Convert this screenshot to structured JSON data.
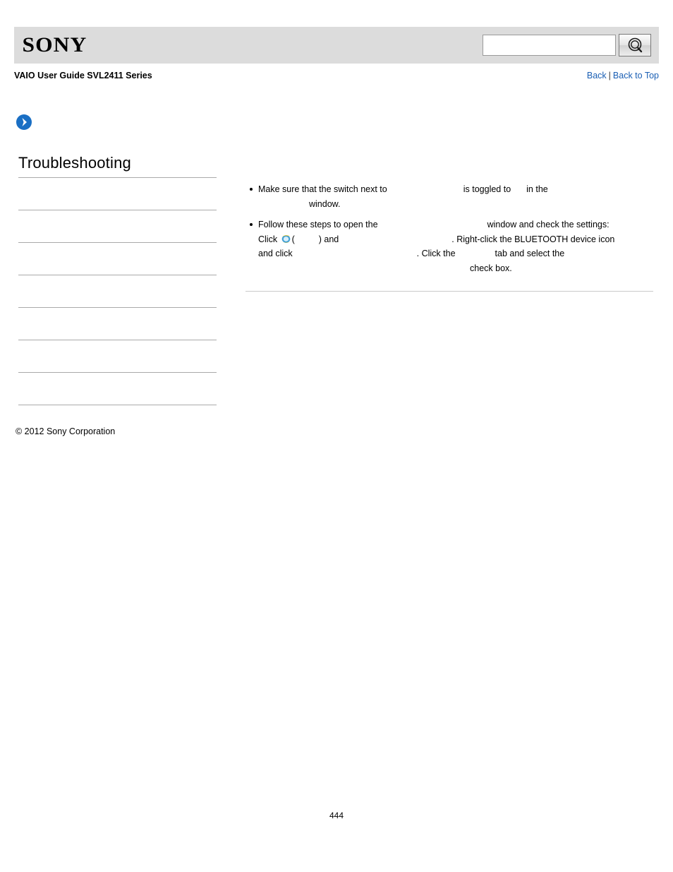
{
  "header": {
    "logo_text": "SONY",
    "search_placeholder": "",
    "search_value": "",
    "search_button_icon": "search-icon"
  },
  "subheader": {
    "guide_title": "VAIO User Guide SVL2411 Series",
    "back_label": "Back",
    "separator": "|",
    "back_to_top_label": "Back to Top"
  },
  "left": {
    "page_title": "Troubleshooting",
    "toc_items": [
      {
        "label": ""
      },
      {
        "label": ""
      },
      {
        "label": ""
      },
      {
        "label": ""
      },
      {
        "label": ""
      },
      {
        "label": ""
      },
      {
        "label": ""
      }
    ],
    "copyright": "© 2012 Sony Corporation"
  },
  "content": {
    "bullet1": {
      "line1_a": "Make sure that the switch next to",
      "line1_b": "is toggled to",
      "line1_c": "in the",
      "line2": "window."
    },
    "bullet2": {
      "line1_a": "Follow these steps to open the",
      "line1_b": "window and check the settings:",
      "line2_a": "Click",
      "line2_b": "(",
      "line2_c": ") and",
      "line2_d": ". Right-click the BLUETOOTH device icon",
      "line3_a": "and click",
      "line3_b": ". Click the",
      "line3_c": "tab and select the",
      "line4": "check box."
    }
  },
  "footer": {
    "page_number": "444"
  }
}
